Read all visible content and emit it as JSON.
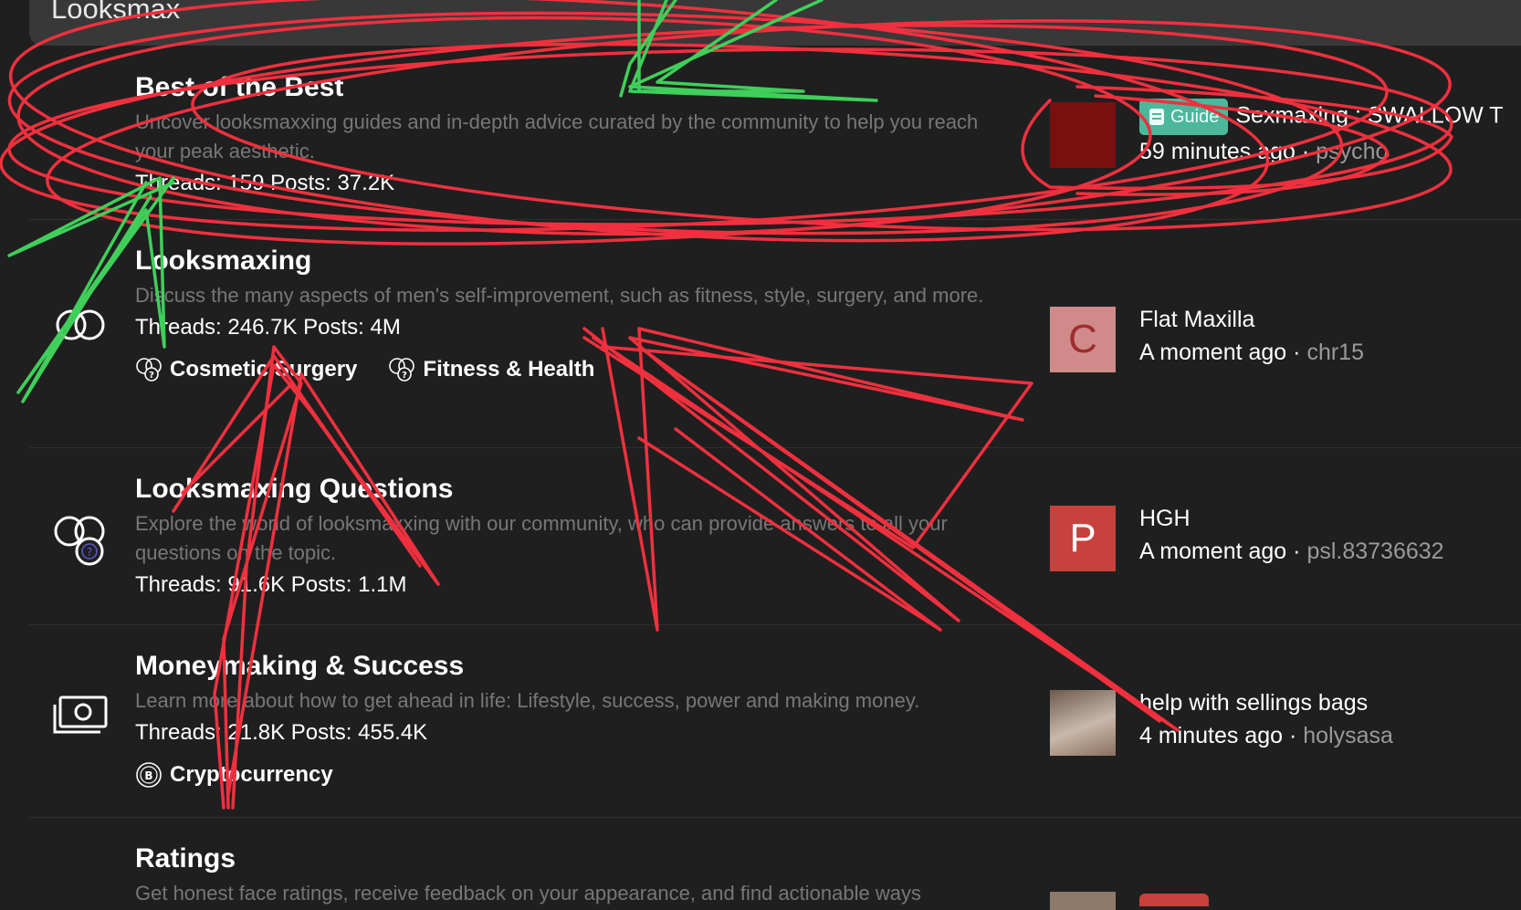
{
  "category": {
    "title": "Looksmax"
  },
  "forums": [
    {
      "title": "Best of the Best",
      "desc": "Uncover looksmaxxing guides and in-depth advice curated by the community to help you reach your peak aesthetic.",
      "stats": "Threads: 159 Posts: 37.2K",
      "last": {
        "prefix": "Guide",
        "title": "Sexmaxing : SWALLOW T",
        "time": "59 minutes ago",
        "user": "psycho"
      }
    },
    {
      "title": "Looksmaxing",
      "desc": "Discuss the many aspects of men's self-improvement, such as fitness, style, surgery, and more.",
      "stats": "Threads: 246.7K Posts: 4M",
      "subforums": [
        "Cosmetic Surgery",
        "Fitness & Health"
      ],
      "last": {
        "avatar_letter": "C",
        "avatar_color": "#d08a8a",
        "title": "Flat Maxilla",
        "time": "A moment ago",
        "user": "chr15"
      }
    },
    {
      "title": "Looksmaxing Questions",
      "desc": "Explore the world of looksmaxxing with our community, who can provide answers to all your questions on the topic.",
      "stats": "Threads: 91.6K Posts: 1.1M",
      "last": {
        "avatar_letter": "P",
        "avatar_color": "#c8413c",
        "title": "HGH",
        "time": "A moment ago",
        "user": "psl.83736632"
      }
    },
    {
      "title": "Moneymaking & Success",
      "desc": "Learn more about how to get ahead in life: Lifestyle, success, power and making money.",
      "stats": "Threads: 21.8K Posts: 455.4K",
      "subforums": [
        "Cryptocurrency"
      ],
      "last": {
        "title": "help with sellings bags",
        "time": "4 minutes ago",
        "user": "holysasa"
      }
    },
    {
      "title": "Ratings",
      "desc": "Get honest face ratings, receive feedback on your appearance, and find actionable ways"
    }
  ],
  "meta_separator": " · ",
  "colors": {
    "bg": "#1f1f1f",
    "header": "#383838",
    "prefix": "#4bb89c",
    "annotation_red": "#f0303e",
    "annotation_green": "#3fcf5a"
  }
}
